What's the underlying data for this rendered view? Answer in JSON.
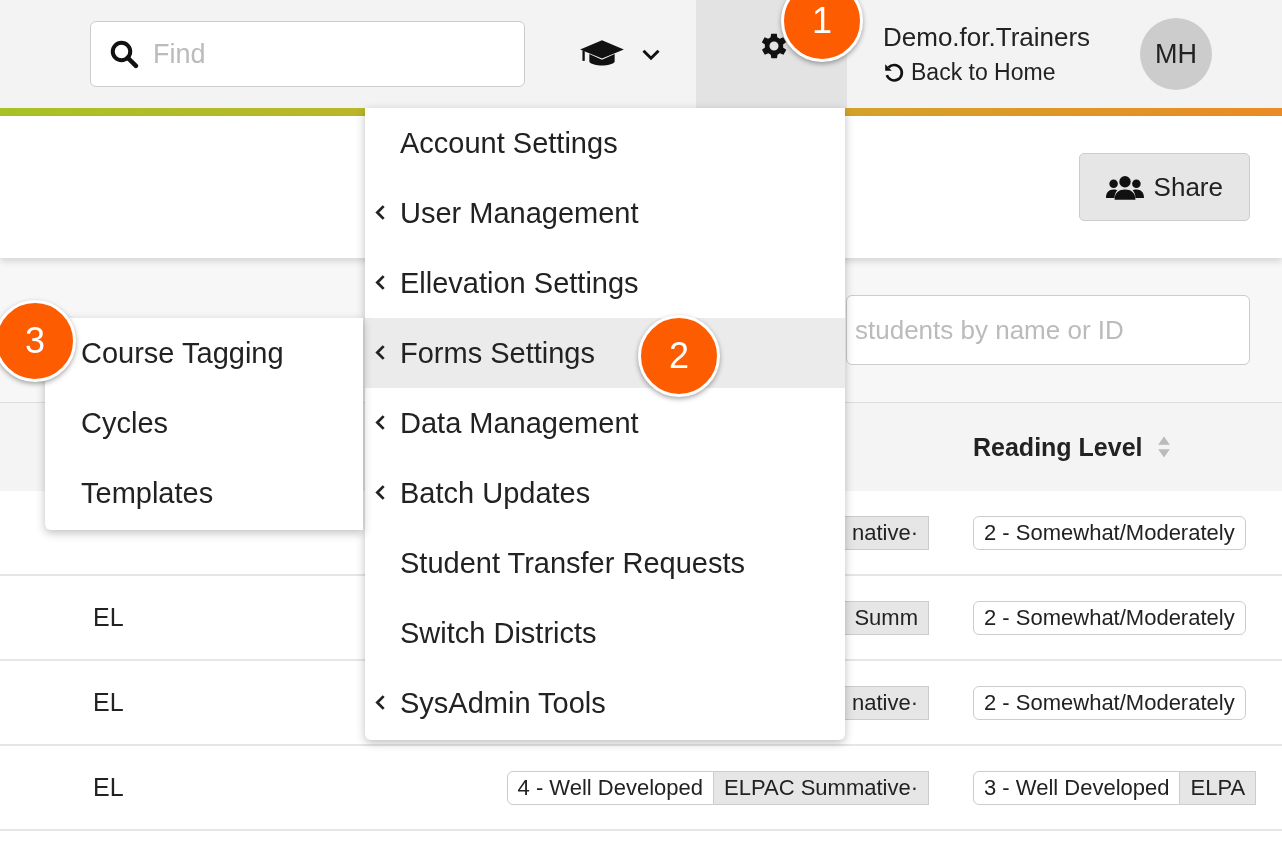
{
  "header": {
    "search": {
      "placeholder": "Find"
    },
    "settings_button": {
      "open": true,
      "badge": "1"
    },
    "user_name": "Demo.for.Trainers",
    "back_link": "Back to Home",
    "avatar": "MH"
  },
  "toolbar": {
    "share_button": "Share"
  },
  "student_search": {
    "placeholder": "students by name or ID"
  },
  "settings_menu": [
    {
      "label": "Account Settings",
      "has_submenu": false,
      "selected": false
    },
    {
      "label": "User Management",
      "has_submenu": true,
      "selected": false
    },
    {
      "label": "Ellevation Settings",
      "has_submenu": true,
      "selected": false
    },
    {
      "label": "Forms Settings",
      "has_submenu": true,
      "selected": true,
      "badge": "2"
    },
    {
      "label": "Data Management",
      "has_submenu": true,
      "selected": false
    },
    {
      "label": "Batch Updates",
      "has_submenu": true,
      "selected": false
    },
    {
      "label": "Student Transfer Requests",
      "has_submenu": false,
      "selected": false
    },
    {
      "label": "Switch Districts",
      "has_submenu": false,
      "selected": false
    },
    {
      "label": "SysAdmin Tools",
      "has_submenu": true,
      "selected": false
    }
  ],
  "forms_submenu": [
    {
      "label": "Course Tagging",
      "badge": "3"
    },
    {
      "label": "Cycles"
    },
    {
      "label": "Templates"
    }
  ],
  "table": {
    "columns": [
      {
        "label": "Reading Level"
      }
    ],
    "rows": [
      {
        "column_2": [
          {
            "text": "native·",
            "kind": "source"
          }
        ],
        "reading_level": [
          {
            "text": "2 - Somewhat/Moderately",
            "kind": "score"
          }
        ]
      },
      {
        "column_1": "EL",
        "column_2": [
          {
            "text": "Summ",
            "kind": "source"
          }
        ],
        "reading_level": [
          {
            "text": "2 - Somewhat/Moderately",
            "kind": "score"
          }
        ]
      },
      {
        "column_1": "EL",
        "column_2": [
          {
            "text": "native·",
            "kind": "source"
          }
        ],
        "reading_level": [
          {
            "text": "2 - Somewhat/Moderately",
            "kind": "score"
          }
        ]
      },
      {
        "column_1": "EL",
        "column_2": [
          {
            "text": "4 - Well Developed",
            "kind": "score"
          },
          {
            "text": "ELPAC Summative·",
            "kind": "source"
          }
        ],
        "reading_level": [
          {
            "text": "3 - Well Developed",
            "kind": "score"
          },
          {
            "text": "ELPA",
            "kind": "source"
          }
        ]
      }
    ]
  }
}
